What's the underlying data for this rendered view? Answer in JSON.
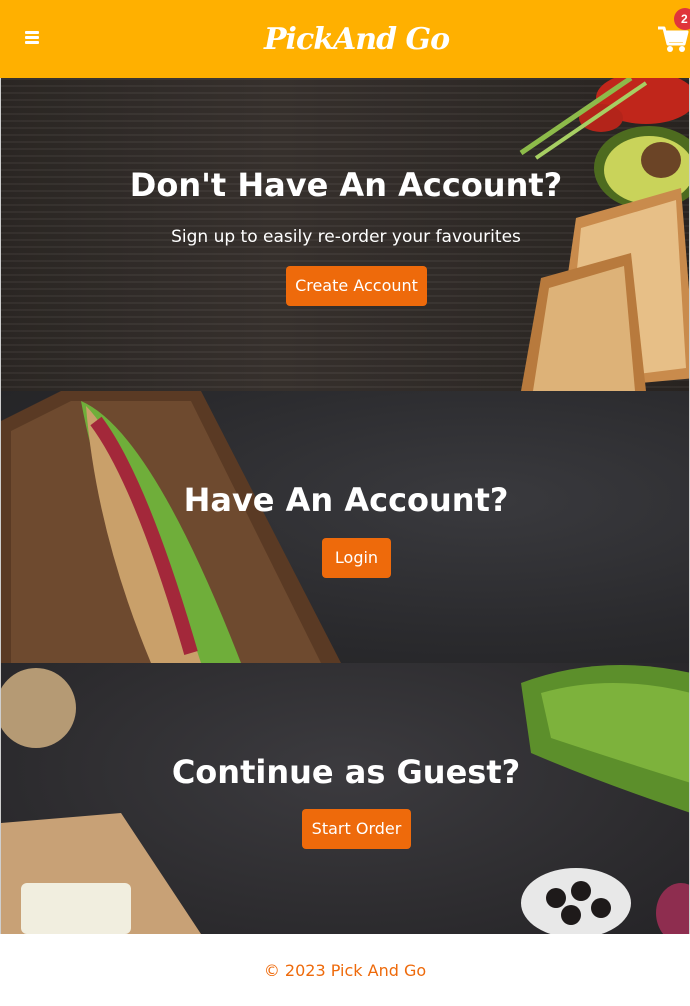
{
  "header": {
    "logo_text": "PickAnd Go",
    "cart_count": "2",
    "colors": {
      "background": "#FFB000",
      "badge": "#E0353B"
    },
    "icons": {
      "menu": "hamburger-menu-icon",
      "cart": "shopping-cart-icon"
    }
  },
  "sections": {
    "signup": {
      "title": "Don't Have An Account?",
      "subtitle": "Sign up to easily re-order your favourites",
      "button": "Create Account"
    },
    "login": {
      "title": "Have An Account?",
      "button": "Login"
    },
    "guest": {
      "title": "Continue as Guest?",
      "button": "Start Order"
    }
  },
  "footer": {
    "copyright": "© 2023 Pick And Go"
  },
  "theme": {
    "accent": "#EE6A0B"
  }
}
